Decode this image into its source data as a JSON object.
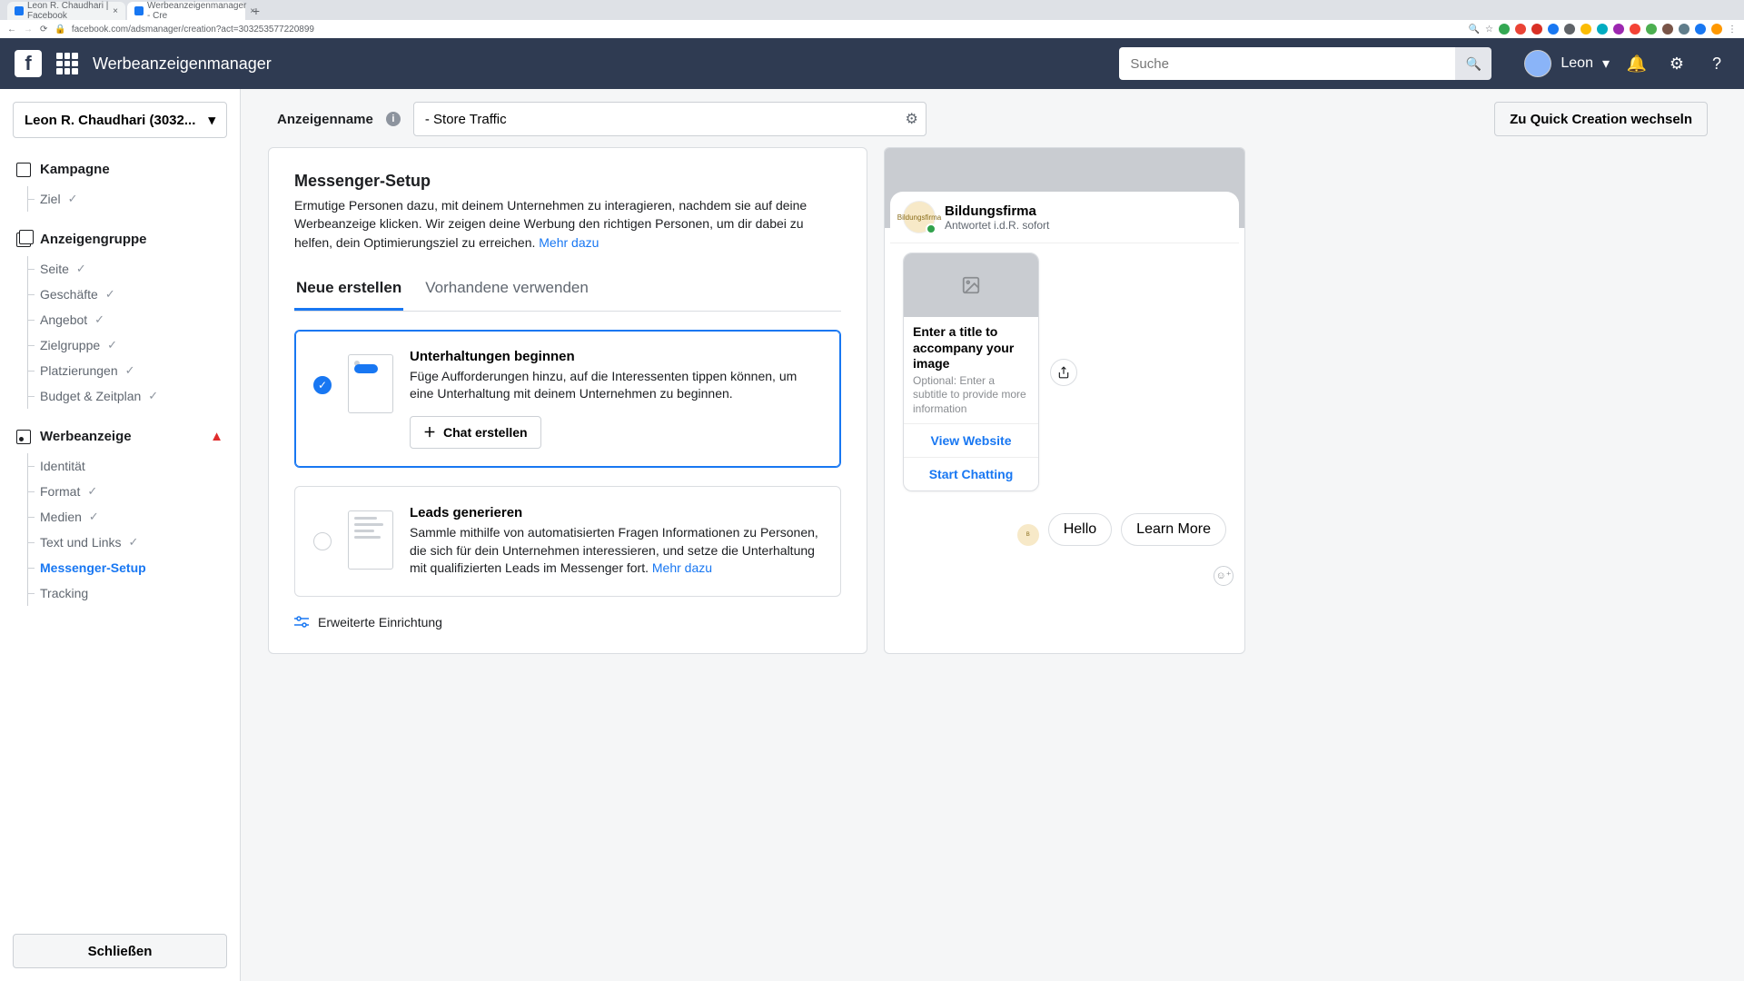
{
  "browser": {
    "tabs": [
      {
        "title": "Leon R. Chaudhari | Facebook"
      },
      {
        "title": "Werbeanzeigenmanager - Cre"
      }
    ],
    "url": "facebook.com/adsmanager/creation?act=303253577220899"
  },
  "topbar": {
    "app_title": "Werbeanzeigenmanager",
    "search_placeholder": "Suche",
    "user_name": "Leon"
  },
  "sidebar": {
    "account_label": "Leon R. Chaudhari (3032...",
    "kampagne": {
      "label": "Kampagne",
      "items": [
        {
          "label": "Ziel"
        }
      ]
    },
    "anzeigengruppe": {
      "label": "Anzeigengruppe",
      "items": [
        {
          "label": "Seite"
        },
        {
          "label": "Geschäfte"
        },
        {
          "label": "Angebot"
        },
        {
          "label": "Zielgruppe"
        },
        {
          "label": "Platzierungen"
        },
        {
          "label": "Budget & Zeitplan"
        }
      ]
    },
    "werbeanzeige": {
      "label": "Werbeanzeige",
      "items": [
        {
          "label": "Identität"
        },
        {
          "label": "Format"
        },
        {
          "label": "Medien"
        },
        {
          "label": "Text und Links"
        },
        {
          "label": "Messenger-Setup"
        },
        {
          "label": "Tracking"
        }
      ]
    },
    "close_label": "Schließen"
  },
  "header": {
    "ad_name_label": "Anzeigenname",
    "ad_name_value": "- Store Traffic",
    "quick_label": "Zu Quick Creation wechseln"
  },
  "panel": {
    "title": "Messenger-Setup",
    "desc": "Ermutige Personen dazu, mit deinem Unternehmen zu interagieren, nachdem sie auf deine Werbeanzeige klicken. Wir zeigen deine Werbung den richtigen Personen, um dir dabei zu helfen, dein Optimierungsziel zu erreichen. ",
    "more": "Mehr dazu",
    "tabs": {
      "new": "Neue erstellen",
      "existing": "Vorhandene verwenden"
    },
    "opt1": {
      "title": "Unterhaltungen beginnen",
      "desc": "Füge Aufforderungen hinzu, auf die Interessenten tippen können, um eine Unterhaltung mit deinem Unternehmen zu beginnen.",
      "button": "Chat erstellen"
    },
    "opt2": {
      "title": "Leads generieren",
      "desc": "Sammle mithilfe von automatisierten Fragen Informationen zu Personen, die sich für dein Unternehmen interessieren, und setze die Unterhaltung mit qualifizierten Leads im Messenger fort. ",
      "more": "Mehr dazu"
    },
    "advanced": "Erweiterte Einrichtung"
  },
  "preview": {
    "page_name": "Bildungsfirma",
    "page_sub": "Antwortet i.d.R. sofort",
    "card_title": "Enter a title to accompany your image",
    "card_sub": "Optional: Enter a subtitle to provide more information",
    "link1": "View Website",
    "link2": "Start Chatting",
    "pill1": "Hello",
    "pill2": "Learn More"
  }
}
